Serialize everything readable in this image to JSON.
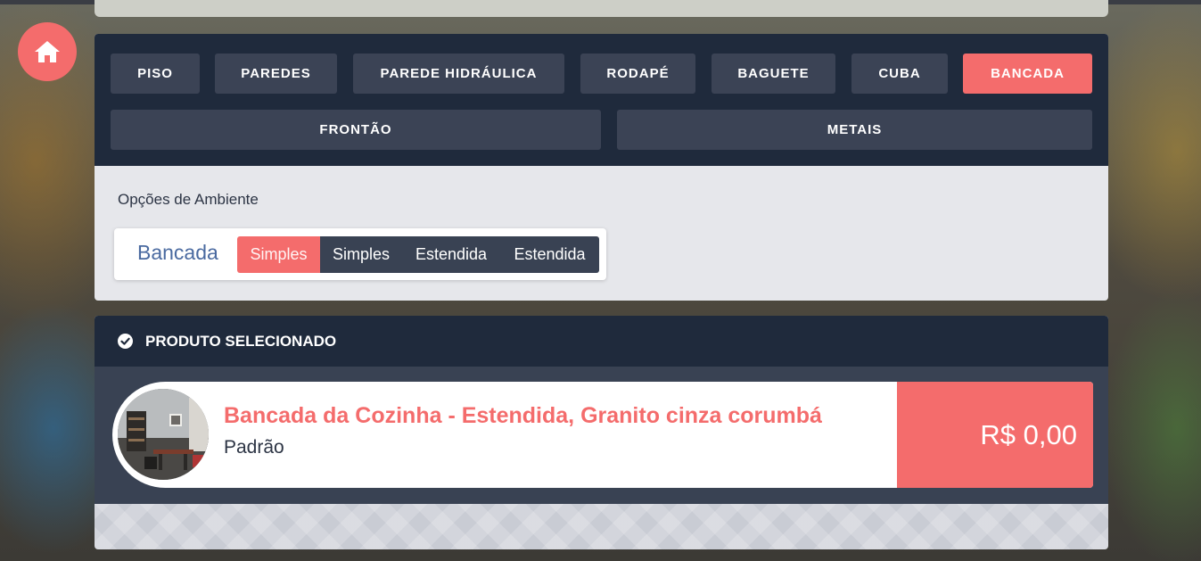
{
  "colors": {
    "accent": "#f46c6c",
    "dark_navy": "#1f2a3c",
    "tab_gray": "#3b4355",
    "panel_light": "#e6e7eb",
    "option_label_blue": "#4a6aa0"
  },
  "home": {
    "icon": "home-icon"
  },
  "tabs": [
    {
      "label": "PISO",
      "active": false
    },
    {
      "label": "PAREDES",
      "active": false
    },
    {
      "label": "PAREDE HIDRÁULICA",
      "active": false
    },
    {
      "label": "RODAPÉ",
      "active": false
    },
    {
      "label": "BAGUETE",
      "active": false
    },
    {
      "label": "CUBA",
      "active": false
    },
    {
      "label": "BANCADA",
      "active": true
    },
    {
      "label": "FRONTÃO",
      "active": false
    },
    {
      "label": "METAIS",
      "active": false
    }
  ],
  "options": {
    "section_label": "Opções de Ambiente",
    "group_label": "Bancada",
    "segments": [
      {
        "label": "Simples",
        "active": true
      },
      {
        "label": "Simples",
        "active": false
      },
      {
        "label": "Estendida",
        "active": false
      },
      {
        "label": "Estendida",
        "active": false
      }
    ]
  },
  "product": {
    "header_icon": "check-circle-icon",
    "header_title": "PRODUTO SELECIONADO",
    "thumbnail_icon": "room-thumbnail",
    "title": "Bancada da Cozinha - Estendida, Granito cinza corumbá",
    "subtitle": "Padrão",
    "price": "R$ 0,00"
  }
}
